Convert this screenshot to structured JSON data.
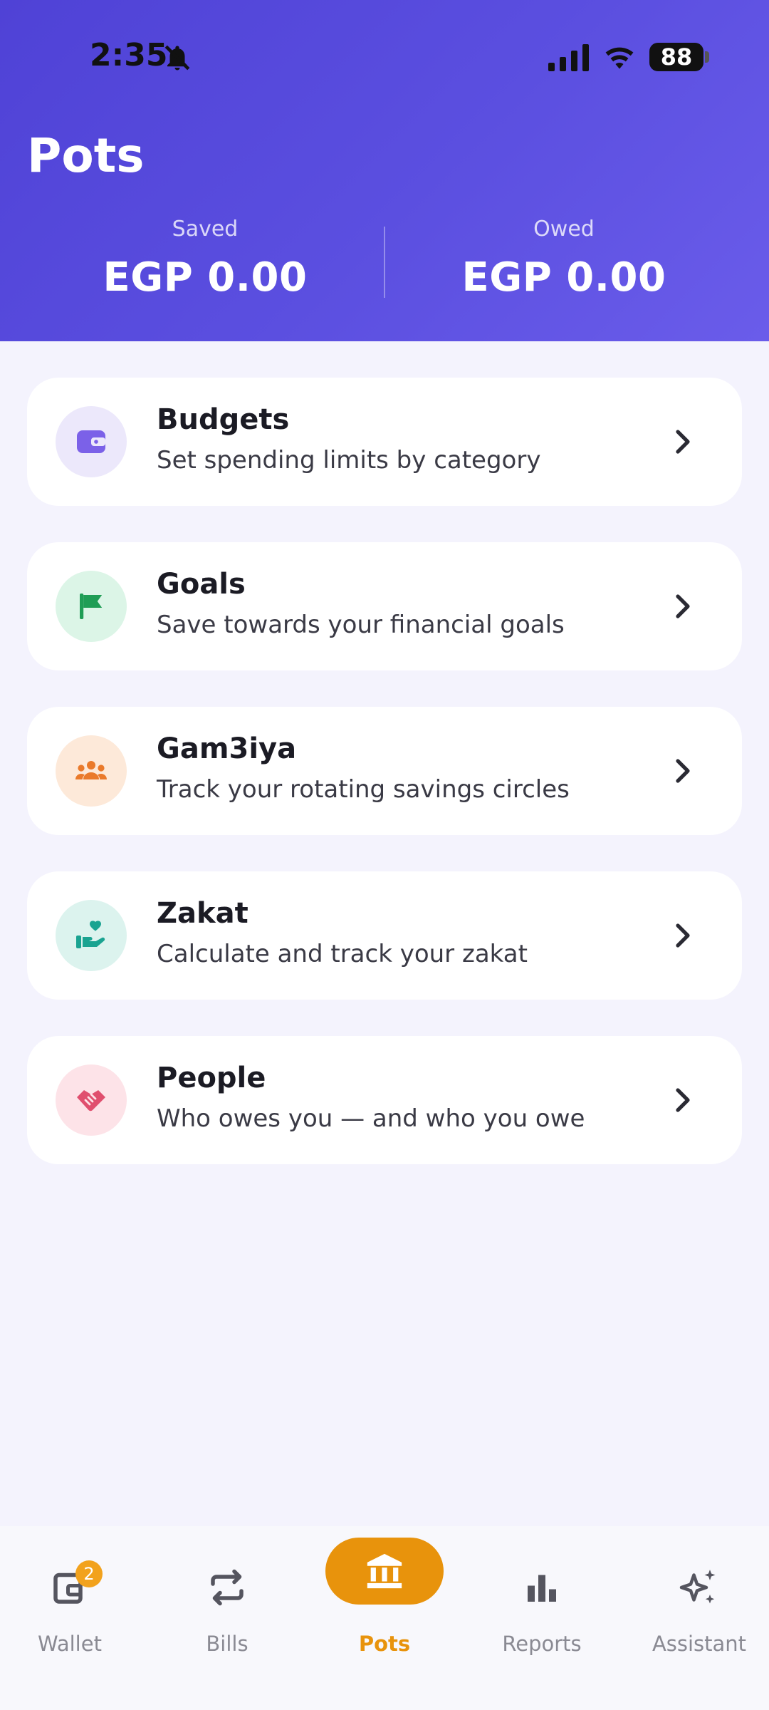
{
  "status_bar": {
    "time": "2:35",
    "battery": "88"
  },
  "header": {
    "title": "Pots",
    "saved": {
      "label": "Saved",
      "value": "EGP 0.00"
    },
    "owed": {
      "label": "Owed",
      "value": "EGP 0.00"
    }
  },
  "cards": [
    {
      "title": "Budgets",
      "subtitle": "Set spending limits by category",
      "icon": "wallet-icon",
      "color": "#7b61e8",
      "bg": "#ece8fb"
    },
    {
      "title": "Goals",
      "subtitle": "Save towards your financial goals",
      "icon": "flag-icon",
      "color": "#1f9d55",
      "bg": "#dcf5e7"
    },
    {
      "title": "Gam3iya",
      "subtitle": "Track your rotating savings circles",
      "icon": "group-icon",
      "color": "#ea7a2b",
      "bg": "#fde9d9"
    },
    {
      "title": "Zakat",
      "subtitle": "Calculate and track your zakat",
      "icon": "hand-heart-icon",
      "color": "#1aa391",
      "bg": "#dcf3ee"
    },
    {
      "title": "People",
      "subtitle": "Who owes you — and who you owe",
      "icon": "handshake-icon",
      "color": "#e04f6e",
      "bg": "#fde3e8"
    }
  ],
  "nav": {
    "items": [
      {
        "label": "Wallet",
        "icon": "wallet-icon",
        "badge": "2"
      },
      {
        "label": "Bills",
        "icon": "repeat-icon"
      },
      {
        "label": "Pots",
        "icon": "bank-icon",
        "active": true
      },
      {
        "label": "Reports",
        "icon": "bar-chart-icon"
      },
      {
        "label": "Assistant",
        "icon": "sparkles-icon"
      }
    ],
    "active_color": "#e8930c"
  }
}
